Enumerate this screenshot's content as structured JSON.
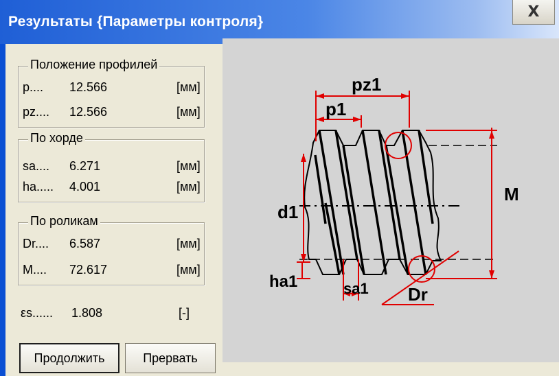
{
  "window": {
    "title": "Результаты {Параметры контроля}",
    "close_glyph": "X"
  },
  "groups": {
    "profiles": {
      "title": "Положение профилей",
      "rows": [
        {
          "label": "p....",
          "value": "12.566",
          "unit": "[мм]"
        },
        {
          "label": "pz....",
          "value": "12.566",
          "unit": "[мм]"
        }
      ]
    },
    "chord": {
      "title": "По хорде",
      "rows": [
        {
          "label": "sa....",
          "value": "6.271",
          "unit": "[мм]"
        },
        {
          "label": "ha.....",
          "value": "4.001",
          "unit": "[мм]"
        }
      ]
    },
    "rollers": {
      "title": "По роликам",
      "rows": [
        {
          "label": "Dr....",
          "value": "6.587",
          "unit": "[мм]"
        },
        {
          "label": "M....",
          "value": "72.617",
          "unit": "[мм]"
        }
      ]
    }
  },
  "epsilon": {
    "label": "εs......",
    "value": "1.808",
    "unit": "[-]"
  },
  "buttons": {
    "continue": "Продолжить",
    "abort": "Прервать"
  },
  "diagram": {
    "labels": {
      "pz1": "pz1",
      "p1": "p1",
      "d1": "d1",
      "M": "M",
      "ha1": "ha1",
      "sa1": "sa1",
      "Dr": "Dr"
    },
    "colors": {
      "dimension": "#e00000",
      "outline": "#000000",
      "background": "#d4d4d4"
    }
  }
}
